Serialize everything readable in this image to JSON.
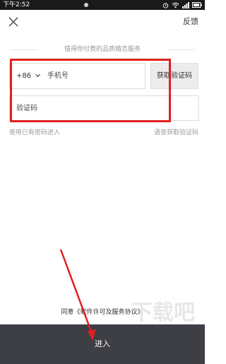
{
  "status_bar": {
    "time": "下午2:52",
    "icons": [
      "alarm-icon",
      "wifi-icon",
      "signal-icon",
      "battery-icon"
    ]
  },
  "header": {
    "close_icon": "close-icon",
    "feedback_label": "反馈"
  },
  "subtitle": "值得你付费的品质婚恋服务",
  "phone": {
    "country_code": "+86",
    "dropdown_icon": "chevron-down-icon",
    "placeholder": "手机号",
    "get_code_label": "获取验证码"
  },
  "code": {
    "placeholder": "验证码"
  },
  "links": {
    "password_login": "使用已有密码进入",
    "voice_code": "语音获取验证码"
  },
  "agreement": "同意《软件许可及服务协议》",
  "enter_label": "进入",
  "watermark": {
    "text": "下载吧",
    "site": "www.xiazaiba.com"
  },
  "annotation_color": "#e02020"
}
